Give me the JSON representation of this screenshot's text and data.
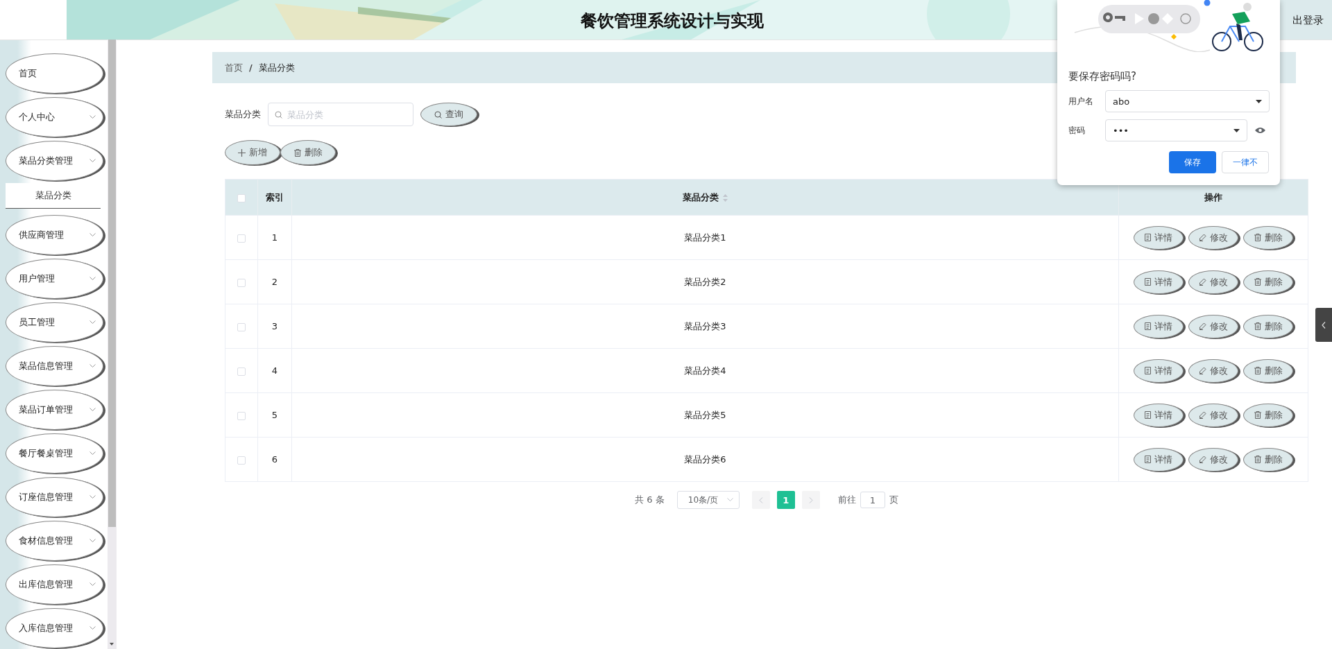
{
  "header": {
    "title": "餐饮管理系统设计与实现",
    "logout": "出登录"
  },
  "sidebar": {
    "items": [
      {
        "label": "首页",
        "kind": "link"
      },
      {
        "label": "个人中心",
        "kind": "menu"
      },
      {
        "label": "菜品分类管理",
        "kind": "menu",
        "children": [
          {
            "label": "菜品分类",
            "selected": true
          }
        ]
      },
      {
        "label": "供应商管理",
        "kind": "menu"
      },
      {
        "label": "用户管理",
        "kind": "menu"
      },
      {
        "label": "员工管理",
        "kind": "menu"
      },
      {
        "label": "菜品信息管理",
        "kind": "menu"
      },
      {
        "label": "菜品订单管理",
        "kind": "menu"
      },
      {
        "label": "餐厅餐桌管理",
        "kind": "menu"
      },
      {
        "label": "订座信息管理",
        "kind": "menu"
      },
      {
        "label": "食材信息管理",
        "kind": "menu"
      },
      {
        "label": "出库信息管理",
        "kind": "menu"
      },
      {
        "label": "入库信息管理",
        "kind": "menu"
      }
    ]
  },
  "breadcrumb": {
    "items": [
      "首页",
      "菜品分类"
    ],
    "separator": "/"
  },
  "search": {
    "label": "菜品分类",
    "placeholder": "菜品分类",
    "button": "查询"
  },
  "toolbar": [
    {
      "label": "新增",
      "kind": "add"
    },
    {
      "label": "删除",
      "kind": "delete"
    }
  ],
  "table": {
    "all_checked": false,
    "columns": [
      {
        "label": "索引",
        "sortable": false
      },
      {
        "label": "菜品分类",
        "sortable": true
      },
      {
        "label": "操作",
        "sortable": false
      }
    ],
    "rows": [
      {
        "checked": false,
        "index": "1",
        "name": "菜品分类1",
        "actions": [
          {
            "label": "详情",
            "kind": "detail"
          },
          {
            "label": "修改",
            "kind": "edit"
          },
          {
            "label": "删除",
            "kind": "delete"
          }
        ]
      },
      {
        "checked": false,
        "index": "2",
        "name": "菜品分类2",
        "actions": [
          {
            "label": "详情",
            "kind": "detail"
          },
          {
            "label": "修改",
            "kind": "edit"
          },
          {
            "label": "删除",
            "kind": "delete"
          }
        ]
      },
      {
        "checked": false,
        "index": "3",
        "name": "菜品分类3",
        "actions": [
          {
            "label": "详情",
            "kind": "detail"
          },
          {
            "label": "修改",
            "kind": "edit"
          },
          {
            "label": "删除",
            "kind": "delete"
          }
        ]
      },
      {
        "checked": false,
        "index": "4",
        "name": "菜品分类4",
        "actions": [
          {
            "label": "详情",
            "kind": "detail"
          },
          {
            "label": "修改",
            "kind": "edit"
          },
          {
            "label": "删除",
            "kind": "delete"
          }
        ]
      },
      {
        "checked": false,
        "index": "5",
        "name": "菜品分类5",
        "actions": [
          {
            "label": "详情",
            "kind": "detail"
          },
          {
            "label": "修改",
            "kind": "edit"
          },
          {
            "label": "删除",
            "kind": "delete"
          }
        ]
      },
      {
        "checked": false,
        "index": "6",
        "name": "菜品分类6",
        "actions": [
          {
            "label": "详情",
            "kind": "detail"
          },
          {
            "label": "修改",
            "kind": "edit"
          },
          {
            "label": "删除",
            "kind": "delete"
          }
        ]
      }
    ]
  },
  "pagination": {
    "total": "共 6 条",
    "page_size": "10条/页",
    "pages": [
      {
        "label": "1",
        "selected": true
      }
    ],
    "goto_label": "前往",
    "goto_value": "1",
    "page_unit": "页"
  },
  "save_password": {
    "title": "要保存密码吗?",
    "username_label": "用户名",
    "username": "abo",
    "password_label": "密码",
    "password": "•••",
    "save": "保存",
    "never": "一律不"
  }
}
